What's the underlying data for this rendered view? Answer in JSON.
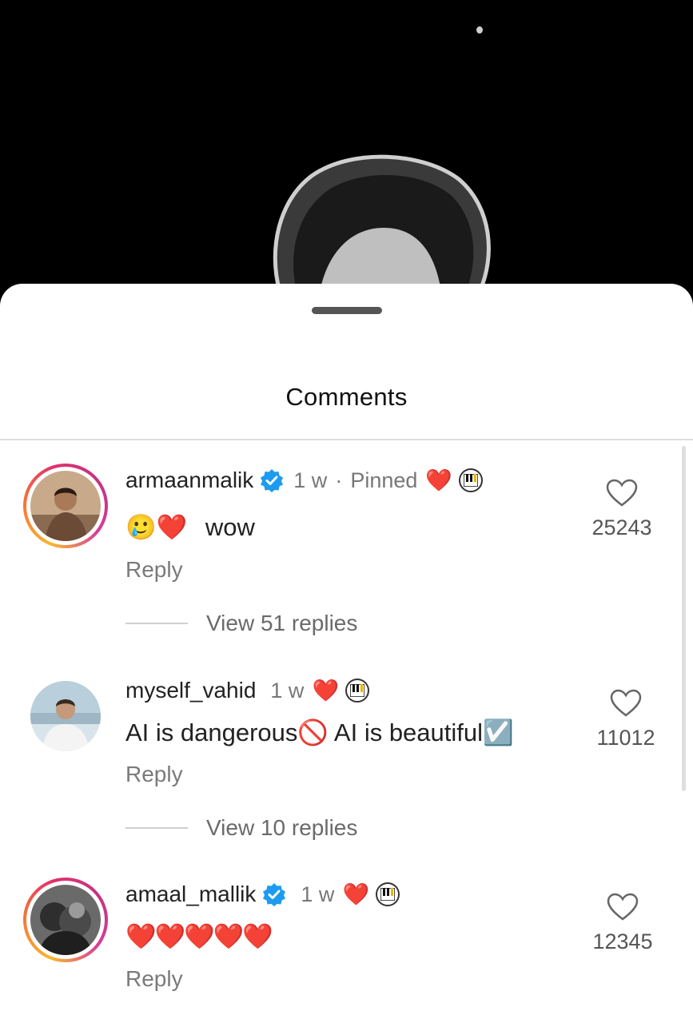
{
  "sheet": {
    "title": "Comments"
  },
  "comments": [
    {
      "username": "armaanmalik",
      "verified": true,
      "time": "1 w",
      "separator": "·",
      "pinned_label": "Pinned",
      "heart_emoji": "❤️",
      "text_emojis": "🥲❤️",
      "text": "wow",
      "reply_label": "Reply",
      "view_replies": "View 51 replies",
      "likes": "25243"
    },
    {
      "username": "myself_vahid",
      "verified": false,
      "time": "1 w",
      "heart_emoji": "❤️",
      "text": "AI is dangerous🚫 AI is beautiful☑️",
      "reply_label": "Reply",
      "view_replies": "View 10 replies",
      "likes": "11012"
    },
    {
      "username": "amaal_mallik",
      "verified": true,
      "time": "1 w",
      "heart_emoji": "❤️",
      "text": "❤️❤️❤️❤️❤️",
      "reply_label": "Reply",
      "likes": "12345"
    }
  ],
  "colors": {
    "verified": "#1d9bf0",
    "heart": "#e8213b",
    "story_ring": "#e1306c"
  }
}
